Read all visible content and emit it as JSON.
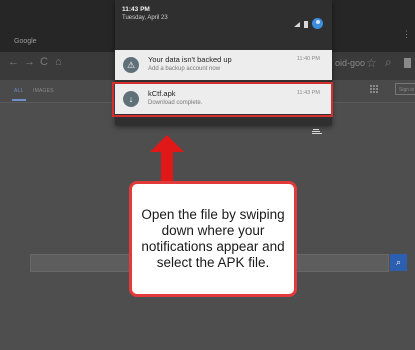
{
  "browser": {
    "tab_title": "Google",
    "url_partial": "oid-goo",
    "search_tabs": [
      "ALL",
      "IMAGES"
    ],
    "signin_partial": "Sign in"
  },
  "status_bar": {
    "time": "11:43 PM",
    "date": "Tuesday, April 23"
  },
  "notifications": [
    {
      "title": "Your data isn't backed up",
      "text": "Add a backup account now",
      "time": "11:40 PM",
      "icon": "warning-icon"
    },
    {
      "title": "kCtf.apk",
      "text": "Download complete.",
      "time": "11:43 PM",
      "icon": "download-icon"
    }
  ],
  "callout": {
    "text": "Open the file by swiping down where your notifications appear and select the APK file."
  },
  "colors": {
    "highlight": "#d32f2f",
    "arrow": "#e01818",
    "accent": "#3d8ddc"
  }
}
